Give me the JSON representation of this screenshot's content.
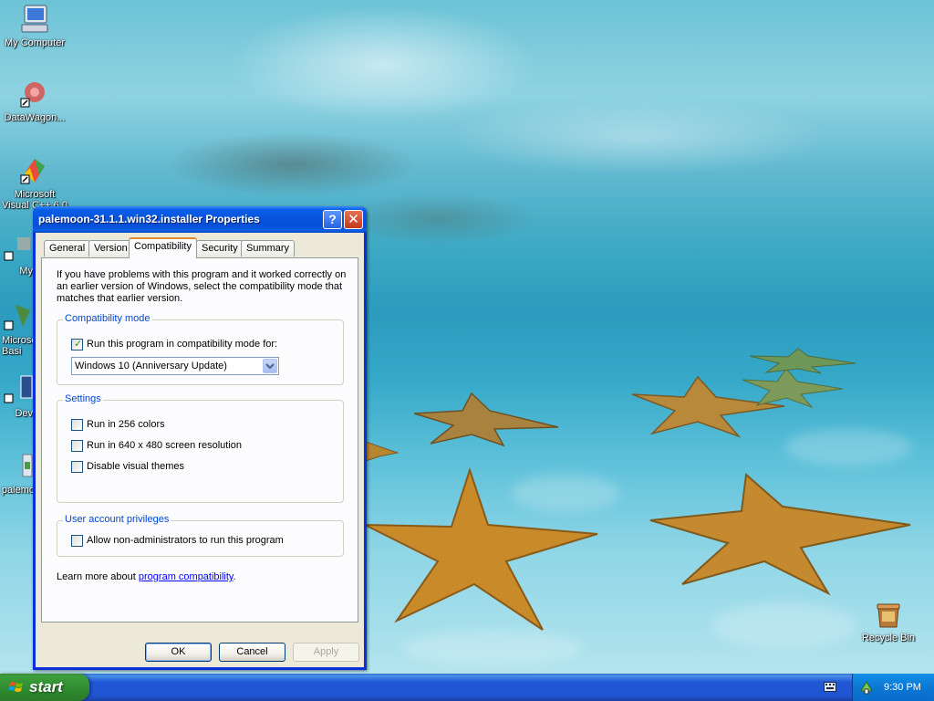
{
  "desktop": {
    "icons": [
      {
        "label": "My Computer"
      },
      {
        "label": "DataWagon..."
      },
      {
        "label": "Microsoft Visual C++ 6.0"
      },
      {
        "label": "My"
      },
      {
        "label": "Microso Basi"
      },
      {
        "label": "Dev"
      },
      {
        "label": "palemo"
      },
      {
        "label": "Recycle Bin"
      }
    ]
  },
  "dialog": {
    "title": "palemoon-31.1.1.win32.installer Properties",
    "tabs": [
      {
        "label": "General"
      },
      {
        "label": "Version"
      },
      {
        "label": "Compatibility"
      },
      {
        "label": "Security"
      },
      {
        "label": "Summary"
      }
    ],
    "active_tab": "Compatibility",
    "intro": "If you have problems with this program and it worked correctly on an earlier version of Windows, select the compatibility mode that matches that earlier version.",
    "compat_mode": {
      "title": "Compatibility mode",
      "checkbox_label": "Run this program in compatibility mode for:",
      "checked": true,
      "selected": "Windows 10 (Anniversary Update)"
    },
    "settings": {
      "title": "Settings",
      "options": [
        {
          "label": "Run in 256 colors",
          "checked": false
        },
        {
          "label": "Run in 640 x 480 screen resolution",
          "checked": false
        },
        {
          "label": "Disable visual themes",
          "checked": false
        }
      ]
    },
    "privileges": {
      "title": "User account privileges",
      "option": {
        "label": "Allow non-administrators to run this program",
        "checked": false
      }
    },
    "learn_prefix": "Learn more about ",
    "learn_link": "program compatibility",
    "learn_suffix": ".",
    "buttons": {
      "ok": "OK",
      "cancel": "Cancel",
      "apply": "Apply"
    }
  },
  "taskbar": {
    "start_label": "start",
    "clock": "9:30 PM"
  },
  "colors": {
    "title_blue": "#0a5fe8",
    "start_green": "#2e8b2e",
    "tab_highlight": "#e68b2c",
    "group_title": "#0046d5"
  }
}
